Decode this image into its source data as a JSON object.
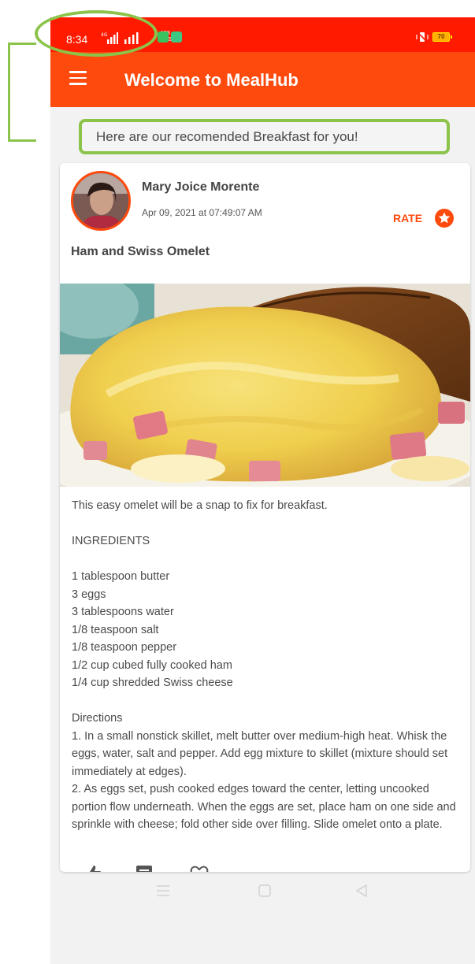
{
  "status_bar": {
    "time": "8:34",
    "network_type": "4G",
    "net_speed_value": "158",
    "net_speed_unit": "KB/S",
    "battery_level": "70"
  },
  "app_bar": {
    "title": "Welcome to MealHub",
    "menu_icon": "hamburger-menu-icon"
  },
  "banner": {
    "text": "Here are our recomended Breakfast for you!"
  },
  "post": {
    "author": "Mary Joice Morente",
    "date": "Apr 09, 2021 at 07:49:07 AM",
    "rate_label": "RATE",
    "rate_icon": "star-icon",
    "title": "Ham and Swiss Omelet",
    "description": "This easy omelet will be a snap to fix for breakfast.",
    "ingredients_heading": "INGREDIENTS",
    "ingredients": [
      "1 tablespoon butter",
      "3 eggs",
      "3 tablespoons water",
      "1/8 teaspoon salt",
      "1/8 teaspoon pepper",
      "1/2 cup cubed fully cooked ham",
      "1/4 cup shredded Swiss cheese"
    ],
    "directions_heading": "Directions",
    "directions": [
      "1. In a small nonstick skillet, melt butter over medium-high heat. Whisk the eggs, water, salt and pepper. Add egg mixture to skillet (mixture should set immediately at edges).",
      "2. As eggs set, push cooked edges toward the center, letting uncooked portion flow underneath. When the eggs are set, place ham on one side and sprinkle with cheese; fold other side over filling. Slide omelet onto a plate."
    ],
    "actions": [
      "like-icon",
      "comment-icon",
      "heart-icon"
    ]
  },
  "colors": {
    "status_bar": "#ff1a00",
    "app_bar": "#ff4a0d",
    "accent": "#ff4a0d",
    "annotation": "#8cc34a"
  },
  "nav_bar": {
    "icons": [
      "recent-apps-icon",
      "home-icon",
      "back-icon"
    ]
  }
}
